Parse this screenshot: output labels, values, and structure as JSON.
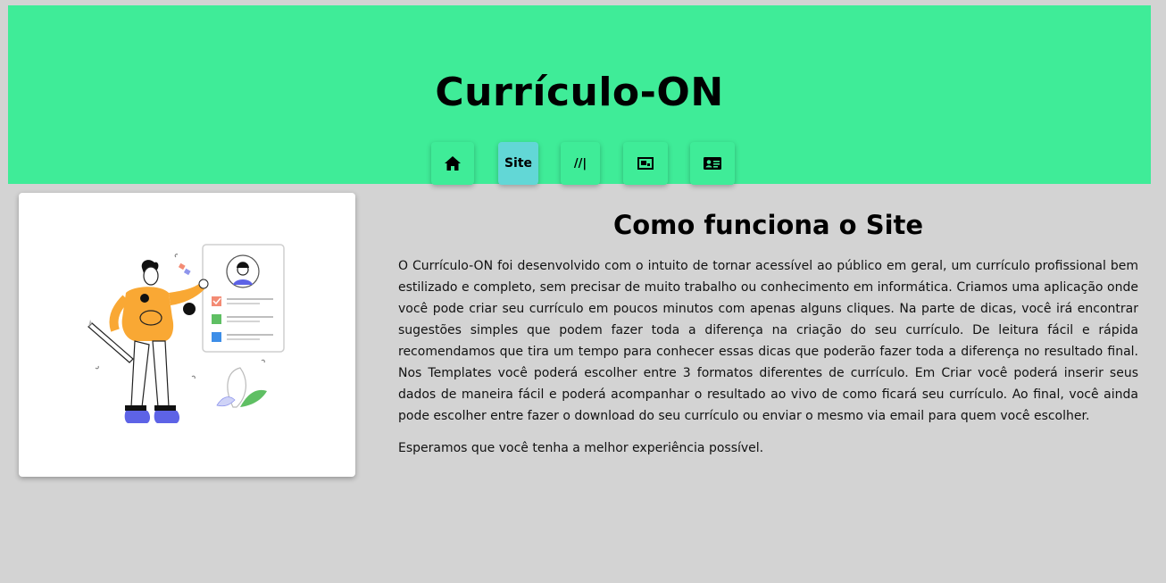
{
  "header": {
    "title": "Currículo-ON",
    "background_color": "#3fec98"
  },
  "nav": {
    "items": [
      {
        "icon": "home-icon",
        "label": "",
        "active": false
      },
      {
        "icon": "",
        "label": "Site",
        "active": true
      },
      {
        "icon": "",
        "label": "//|",
        "active": false
      },
      {
        "icon": "template-icon",
        "label": "",
        "active": false
      },
      {
        "icon": "id-card-icon",
        "label": "",
        "active": false
      }
    ],
    "active_color": "#62d7d6"
  },
  "illustration": {
    "icon": "person-with-resume-illustration"
  },
  "content": {
    "title": "Como funciona o Site",
    "paragraph1": "O Currículo-ON foi desenvolvido com o intuito de tornar acessível ao público em geral, um currículo profissional bem estilizado e completo, sem precisar de muito trabalho ou conhecimento em informática. Criamos uma aplicação onde você pode criar seu currículo em poucos minutos com apenas alguns cliques. Na parte de dicas, você irá encontrar sugestões simples que podem fazer toda a diferença na criação do seu currículo. De leitura fácil e rápida recomendamos que tira um tempo para conhecer essas dicas que poderão fazer toda a diferença no resultado final. Nos Templates você poderá escolher entre 3 formatos diferentes de currículo. Em Criar você poderá inserir seus dados de maneira fácil e poderá acompanhar o resultado ao vivo de como ficará seu currículo. Ao final, você ainda pode escolher entre fazer o download do seu currículo ou enviar o mesmo via email para quem você escolher.",
    "paragraph2": "Esperamos que você tenha a melhor experiência possível."
  },
  "colors": {
    "page_background": "#d3d3d3",
    "card_background": "#ffffff"
  }
}
